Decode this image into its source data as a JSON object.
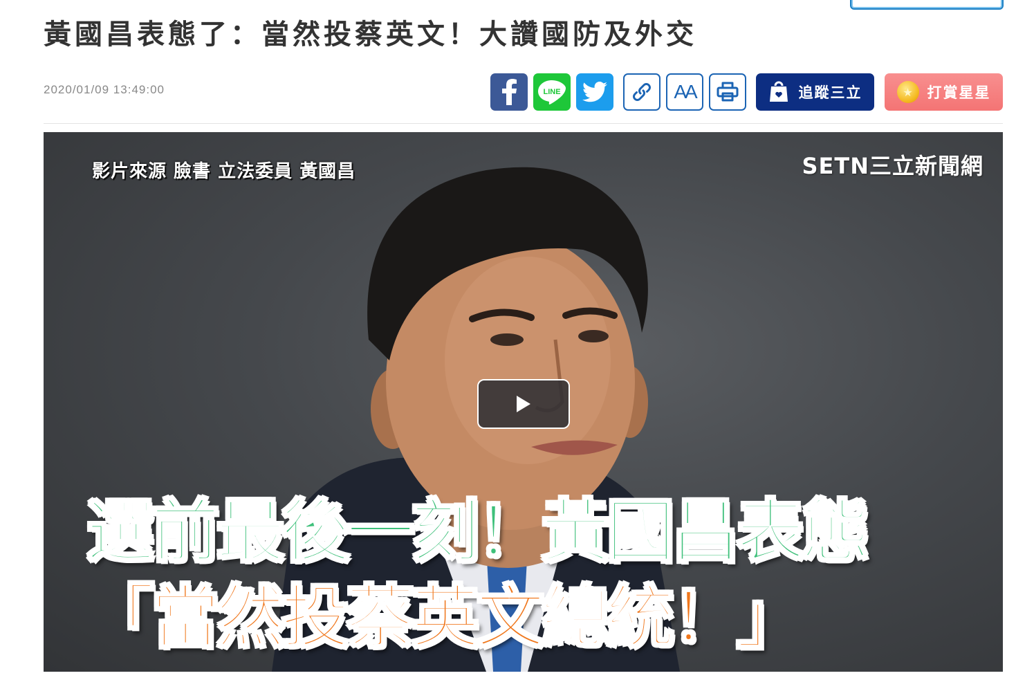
{
  "article": {
    "title": "黃國昌表態了：當然投蔡英文！大讚國防及外交",
    "datetime": "2020/01/09 13:49:00"
  },
  "share": {
    "facebook_icon": "facebook-icon",
    "line_label": "LINE",
    "twitter_icon": "twitter-icon",
    "copy_link_icon": "link-icon",
    "font_size_label": "AA",
    "print_icon": "printer-icon"
  },
  "actions": {
    "follow_label": "追蹤三立",
    "reward_label": "打賞星星"
  },
  "video": {
    "source_text": "影片來源 臉書 立法委員 黃國昌",
    "brand": "SETN三立新聞網",
    "caption_line1": "選前最後一刻！黃國昌表態",
    "caption_line2": "「當然投蔡英文總統！」",
    "play_icon": "play-icon"
  },
  "colors": {
    "facebook": "#3c5997",
    "line": "#1ec739",
    "twitter": "#1c9ded",
    "outline_blue": "#1b64b4",
    "follow_bg": "#0d2e82",
    "reward_bg": "#f47474",
    "caption_green": "#3ec07a",
    "caption_orange": "#f0771c"
  }
}
